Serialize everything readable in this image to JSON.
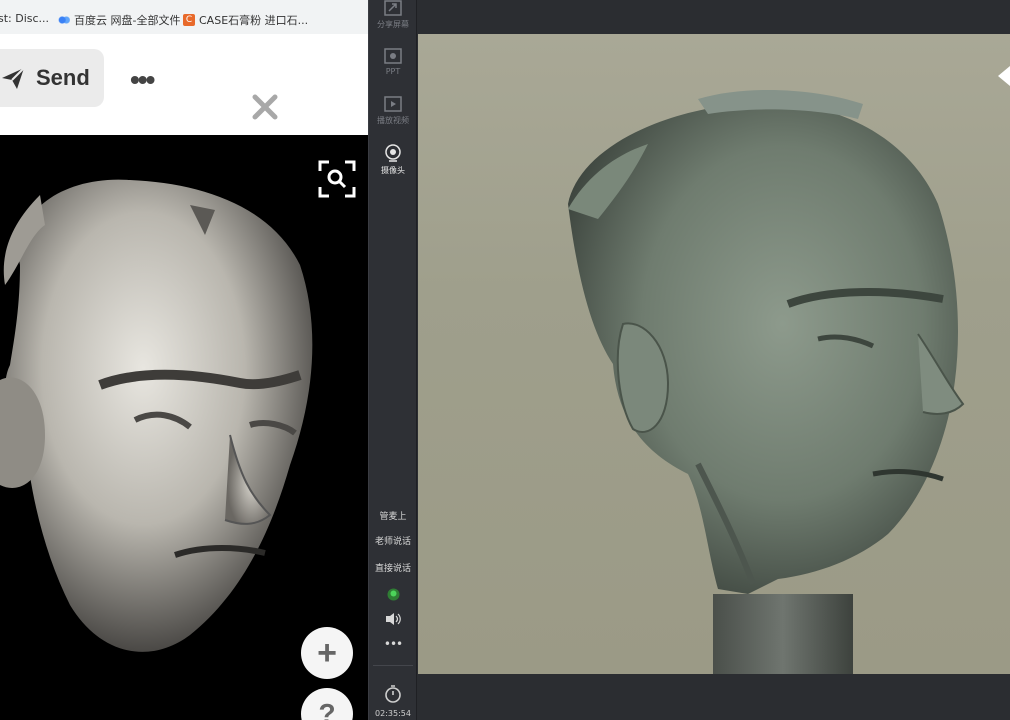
{
  "bookmarks": [
    {
      "label": "st: Disc...",
      "icon": "none"
    },
    {
      "label": "百度云 网盘-全部文件",
      "icon": "cloud-icon"
    },
    {
      "label": "CASE石膏粉 进口石...",
      "icon": "bookmark-favicon-icon"
    }
  ],
  "topbar": {
    "send_label": "Send",
    "more_label": "•••"
  },
  "toolbar": {
    "items": [
      {
        "label": "分享屏幕",
        "icon": "share-screen-icon"
      },
      {
        "label": "PPT",
        "icon": "ppt-icon"
      },
      {
        "label": "播放视频",
        "icon": "play-video-icon"
      },
      {
        "label": "摄像头",
        "icon": "camera-icon"
      }
    ],
    "controls": {
      "mic_label": "管麦上",
      "teacher_label": "老师说话",
      "direct_label": "直接说话"
    },
    "timer": "02:35:54"
  },
  "photo_controls": {
    "plus_label": "+",
    "help_label": "?"
  }
}
